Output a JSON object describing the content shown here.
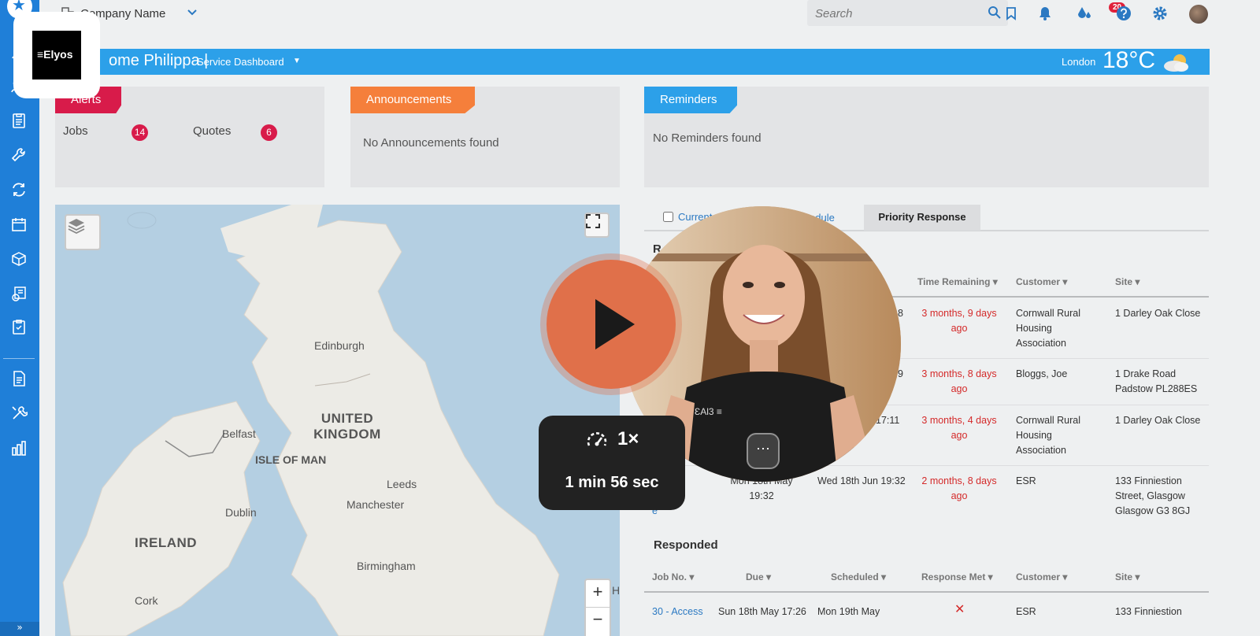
{
  "topbar": {
    "company": "Company Name",
    "search_placeholder": "Search",
    "notifications_count": "20",
    "icons": [
      "bookmark-icon",
      "notifications-icon",
      "drops-icon",
      "help-icon",
      "settings-icon"
    ]
  },
  "welcome": {
    "name": "ome Philippa |",
    "dashboard": "Service Dashboard",
    "city": "London",
    "temperature": "18°C"
  },
  "alerts": {
    "title": "Alerts",
    "jobs_label": "Jobs",
    "jobs_count": "14",
    "quotes_label": "Quotes",
    "quotes_count": "6"
  },
  "announcements": {
    "title": "Announcements",
    "empty": "No Announcements found"
  },
  "reminders": {
    "title": "Reminders",
    "empty": "No Reminders found"
  },
  "map": {
    "labels": {
      "edinburgh": "Edinburgh",
      "uk": "UNITED KINGDOM",
      "belfast": "Belfast",
      "isle_of_man": "ISLE OF MAN",
      "leeds": "Leeds",
      "manchester": "Manchester",
      "dublin": "Dublin",
      "ireland": "IRELAND",
      "birmingham": "Birmingham",
      "cork": "Cork",
      "cut_off": "H"
    },
    "zoom_in": "+",
    "zoom_out": "−"
  },
  "tabs": {
    "current": "Current",
    "schedule": "edule",
    "priority": "Priority Response"
  },
  "response_required": {
    "title": "R",
    "headers": {
      "time_remaining": "Time Remaining ▾",
      "customer": "Customer ▾",
      "site": "Site ▾"
    },
    "rows": [
      {
        "sched_frag": "8",
        "remaining": "3 months, 9 days ago",
        "customer": "Cornwall Rural Housing Association",
        "site": "1 Darley Oak Close"
      },
      {
        "sched_frag": "9",
        "remaining": "3 months, 8 days ago",
        "customer": "Bloggs, Joe",
        "site": "1 Drake Road Padstow PL288ES"
      },
      {
        "sched_frag": "17:11",
        "remaining": "3 months, 4 days ago",
        "customer": "Cornwall Rural Housing Association",
        "site": "1 Darley Oak Close"
      },
      {
        "job": "ccess\nenanc\ne",
        "due": "Mon 18th May\n19:32",
        "scheduled": "Wed 18th Jun 19:32",
        "remaining": "2 months, 8 days ago",
        "customer": "ESR",
        "site": "133 Finniestion Street, Glasgow Glasgow G3 8GJ"
      }
    ]
  },
  "responded": {
    "title": "Responded",
    "headers": {
      "job": "Job No. ▾",
      "due": "Due ▾",
      "scheduled": "Scheduled ▾",
      "response_met": "Response Met ▾",
      "customer": "Customer ▾",
      "site": "Site ▾"
    },
    "rows": [
      {
        "job": "30 - Access",
        "due": "Sun 18th May 17:26",
        "scheduled": "Mon 19th May",
        "response_met": "✕",
        "customer": "ESR",
        "site": "133 Finniestion"
      }
    ]
  },
  "video": {
    "speed": "1×",
    "duration": "1 min 56 sec",
    "more": "⋯",
    "shirt_text": "ƐAl3 ≡"
  },
  "brand": {
    "name": "Elyos"
  },
  "colors": {
    "sidebar": "#1f7fd8",
    "banner": "#2ca0e9",
    "alerts": "#d81b4a",
    "announcements": "#f57f3b",
    "reminders": "#2ca0e9",
    "play": "#e0704a",
    "overdue": "#d42a2a"
  }
}
